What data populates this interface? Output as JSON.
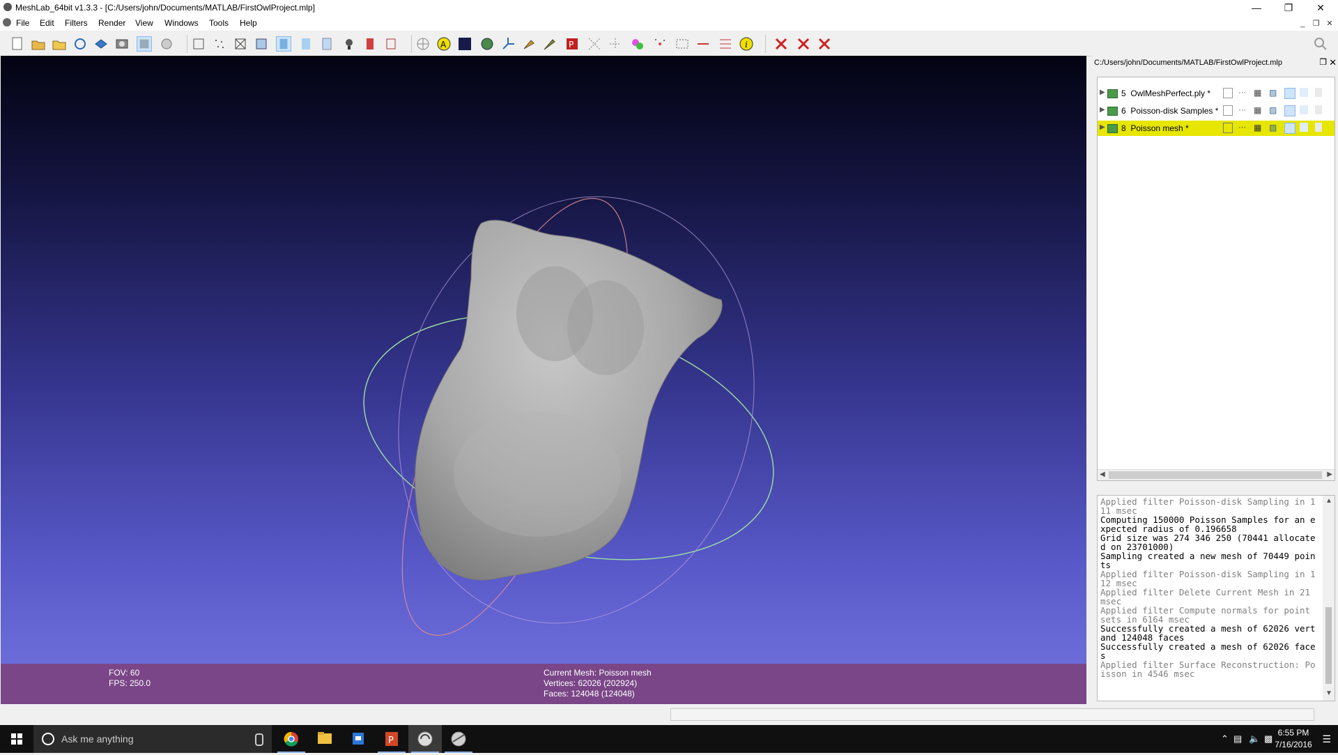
{
  "window": {
    "title": "MeshLab_64bit v1.3.3 - [C:/Users/john/Documents/MATLAB/FirstOwlProject.mlp]",
    "minimize_icon": "minimize-icon",
    "maximize_icon": "restore-icon",
    "close_icon": "close-icon"
  },
  "menu": {
    "items": [
      "File",
      "Edit",
      "Filters",
      "Render",
      "View",
      "Windows",
      "Tools",
      "Help"
    ]
  },
  "viewport": {
    "fov_label": "FOV: 60",
    "fps_label": "FPS:   250.0",
    "current_mesh": "Current Mesh: Poisson mesh",
    "vertices": "Vertices: 62026 (202924)",
    "faces": "Faces: 124048 (124048)",
    "colors": {
      "info_bar": "#7a4687",
      "trackball_green": "#9fe0a0",
      "trackball_red": "#e89090",
      "mesh": "#a8a8a8"
    }
  },
  "layer_panel": {
    "project_path": "C:/Users/john/Documents/MATLAB/FirstOwlProject.mlp",
    "layers": [
      {
        "id": "5",
        "name": "OwlMeshPerfect.ply *",
        "selected": false
      },
      {
        "id": "6",
        "name": "Poisson-disk Samples *",
        "selected": false
      },
      {
        "id": "8",
        "name": "Poisson mesh *",
        "selected": true
      }
    ],
    "selected_color": "#e6e600"
  },
  "log": {
    "lines": [
      {
        "text": "Applied filter Poisson-disk Sampling in 111 msec",
        "style": "dim"
      },
      {
        "text": "Computing 150000 Poisson Samples for an expected radius of 0.196658",
        "style": "bright"
      },
      {
        "text": "Grid size was 274 346 250 (70441 allocated on 23701000)",
        "style": "bright"
      },
      {
        "text": "Sampling created a new mesh of 70449 points",
        "style": "bright"
      },
      {
        "text": "Applied filter Poisson-disk Sampling in 112 msec",
        "style": "dim"
      },
      {
        "text": "Applied filter Delete Current Mesh in 21 msec",
        "style": "dim"
      },
      {
        "text": "Applied filter Compute normals for point sets in 6164 msec",
        "style": "dim"
      },
      {
        "text": "Successfully created a mesh of 62026 vert and 124048 faces",
        "style": "bright"
      },
      {
        "text": "Successfully created a mesh of 62026 faces",
        "style": "bright"
      },
      {
        "text": "Applied filter Surface Reconstruction: Poisson in 4546 msec",
        "style": "dim"
      }
    ]
  },
  "taskbar": {
    "search_placeholder": "Ask me anything",
    "time": "6:55 PM",
    "date": "7/16/2016",
    "apps": [
      "chrome-icon",
      "file-explorer-icon",
      "store-icon",
      "powerpoint-icon",
      "meshlab-icon",
      "meshlab-alt-icon"
    ]
  }
}
